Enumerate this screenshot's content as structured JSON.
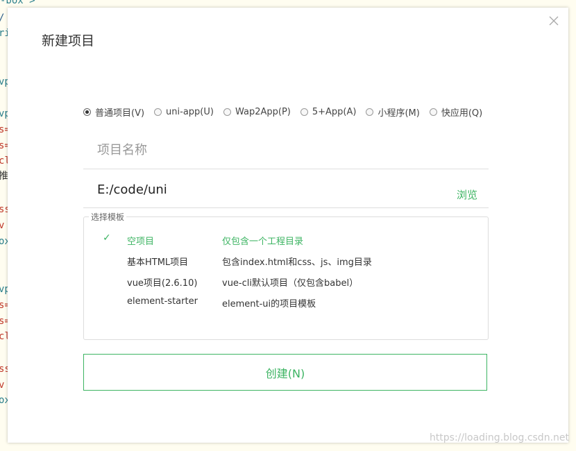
{
  "background_code": {
    "top_line": "-box >",
    "fragments": [
      "/",
      "ri",
      "vp",
      "vp",
      "s=",
      "s=",
      "cl",
      "推",
      "ss",
      " v",
      "ox>",
      "vp",
      "s=",
      "s=",
      "cl",
      "ss",
      " v",
      "ox>"
    ]
  },
  "dialog": {
    "title": "新建项目",
    "close_label": "×"
  },
  "project_types": [
    {
      "label": "普通项目(V)",
      "checked": true
    },
    {
      "label": "uni-app(U)",
      "checked": false
    },
    {
      "label": "Wap2App(P)",
      "checked": false
    },
    {
      "label": "5+App(A)",
      "checked": false
    },
    {
      "label": "小程序(M)",
      "checked": false
    },
    {
      "label": "快应用(Q)",
      "checked": false
    }
  ],
  "form": {
    "name_placeholder": "项目名称",
    "name_value": "",
    "path_value": "E:/code/uni",
    "browse_label": "浏览"
  },
  "templates": {
    "legend": "选择模板",
    "items": [
      {
        "name": "空项目",
        "desc": "仅包含一个工程目录",
        "selected": true
      },
      {
        "name": "基本HTML项目",
        "desc": "包含index.html和css、js、img目录",
        "selected": false
      },
      {
        "name": "vue项目(2.6.10)",
        "desc": "vue-cli默认项目（仅包含babel）",
        "selected": false
      },
      {
        "name": "element-starter",
        "desc": "element-ui的项目模板",
        "selected": false
      }
    ]
  },
  "create_button": "创建(N)",
  "watermark": "https://loading.blog.csdn.net",
  "colors": {
    "accent": "#3cb462",
    "border": "#dedede",
    "text": "#333333"
  }
}
